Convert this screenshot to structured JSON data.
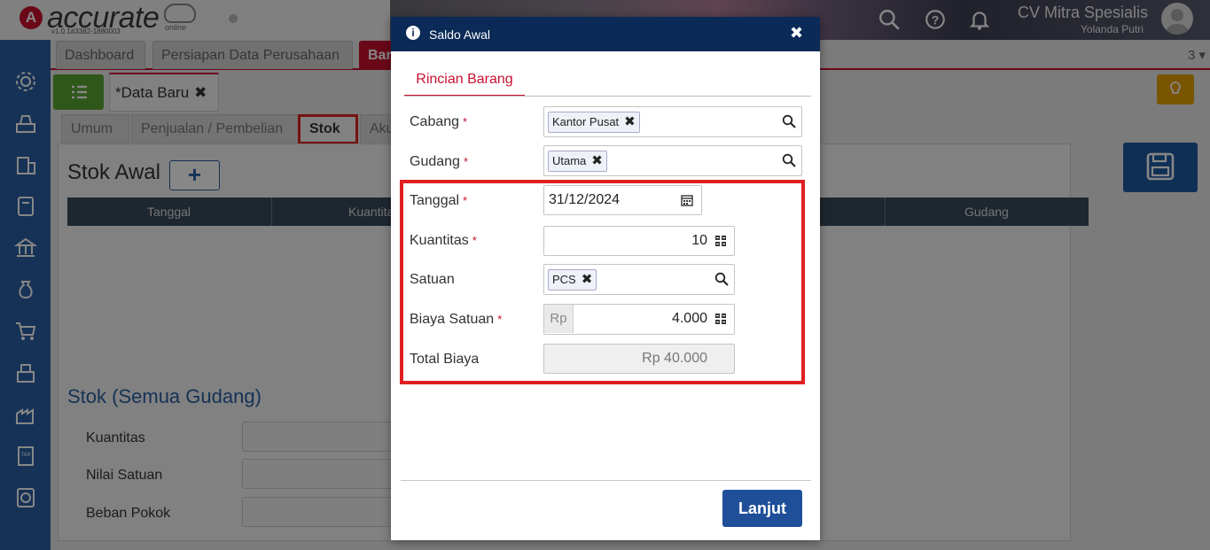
{
  "header": {
    "logo_text": "accurate",
    "logo_sub": "online",
    "version": "v1.0.1#3382-1880003",
    "company": "CV Mitra Spesialis",
    "user": "Yolanda Putri"
  },
  "sidebar": {
    "items": [
      "gear-icon",
      "cashier-icon",
      "building-icon",
      "ledger-icon",
      "bank-icon",
      "money-bag-icon",
      "cart-icon",
      "inventory-icon",
      "factory-icon",
      "tax-icon",
      "report-icon"
    ]
  },
  "app": {
    "tabs": [
      "Dashboard",
      "Persiapan Data Perusahaan",
      "Bar"
    ],
    "tab_count": "3",
    "doc_tab": {
      "modified_mark": "*",
      "label": "Data Baru",
      "close": "✖"
    },
    "subtabs": [
      "Umum",
      "Penjualan / Pembelian",
      "Stok",
      "Aku"
    ],
    "stok_awal_title": "Stok Awal",
    "add_label": "+",
    "grid_columns": [
      "Tanggal",
      "Kuantitas",
      "Gudang"
    ],
    "summary_title": "Stok (Semua Gudang)",
    "summary_fields": [
      "Kuantitas",
      "Nilai Satuan",
      "Beban Pokok"
    ]
  },
  "modal": {
    "title": "Saldo Awal",
    "close": "✖",
    "tab": "Rincian Barang",
    "required_mark": "*",
    "fields": {
      "cabang": {
        "label": "Cabang",
        "value": "Kantor Pusat"
      },
      "gudang": {
        "label": "Gudang",
        "value": "Utama"
      },
      "tanggal": {
        "label": "Tanggal",
        "value": "31/12/2024"
      },
      "kuantitas": {
        "label": "Kuantitas",
        "value": "10"
      },
      "satuan": {
        "label": "Satuan",
        "value": "PCS"
      },
      "biaya": {
        "label": "Biaya Satuan",
        "prefix": "Rp",
        "value": "4.000"
      },
      "total": {
        "label": "Total Biaya",
        "value": "Rp 40.000"
      }
    },
    "submit": "Lanjut"
  },
  "colors": {
    "brand_red": "#c8102e",
    "sidebar_blue": "#2b5fa3",
    "modal_header": "#0b2a57",
    "primary_button": "#1f4f99",
    "highlight": "#e02020"
  }
}
